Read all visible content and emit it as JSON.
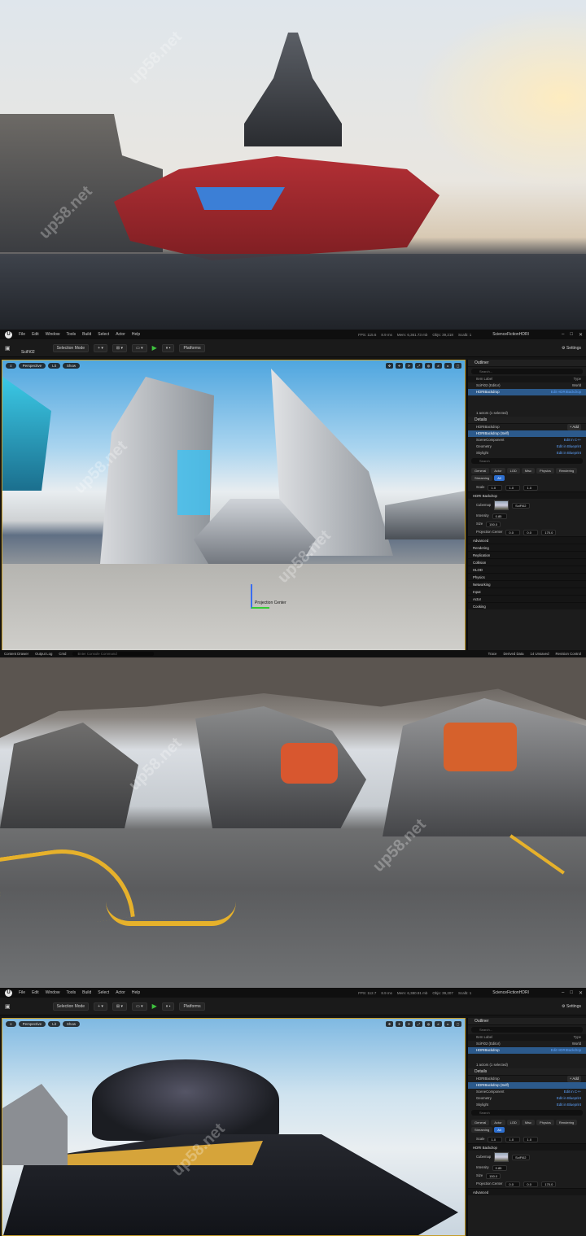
{
  "editor1": {
    "menu": [
      "File",
      "Edit",
      "Window",
      "Tools",
      "Build",
      "Select",
      "Actor",
      "Help"
    ],
    "level": "SciFi02",
    "stats": [
      "FPS: 115.6",
      "8.9 ms",
      "Mem: 6,361.73 mb",
      "Objs: 39,218",
      "Scalb: 1"
    ],
    "project": "ScienceFictionHDRI",
    "mode": "Selection Mode",
    "platforms": "Platforms",
    "settings": "Settings",
    "viewport": {
      "perspective": "Perspective",
      "lit": "Lit",
      "show": "Show",
      "projection_label": "Projection Center"
    },
    "outliner": {
      "title": "Outliner",
      "search": "Search...",
      "col_label": "Item Label",
      "col_type": "Type",
      "rows": [
        {
          "label": "SciFi02 (Editor)",
          "type": "World"
        },
        {
          "label": "HDRIBackdrop",
          "type": "Edit HDRIBackdrop"
        }
      ],
      "footer": "1 actors (1 selected)"
    },
    "details": {
      "title": "Details",
      "actor": "HDRIBackdrop",
      "add": "+ Add",
      "self": "HDRIBackdrop (Self)",
      "components": [
        {
          "label": "SceneComponent",
          "link": "Edit in C++"
        },
        {
          "label": "Geometry",
          "link": "Edit in Blueprint"
        },
        {
          "label": "Skylight",
          "link": "Edit in Blueprint"
        }
      ],
      "search": "Search",
      "tabs": [
        "General",
        "Actor",
        "LOD",
        "Misc",
        "Physics",
        "Rendering",
        "Streaming",
        "All"
      ],
      "scale_label": "Scale",
      "scale": [
        "1.0",
        "1.0",
        "1.0"
      ],
      "section": "HDRI Backdrop",
      "cubemap_label": "Cubemap",
      "cubemap_value": "SciFi02",
      "intensity_label": "Intensity",
      "intensity": "0.85",
      "size_label": "Size",
      "size": "150.0",
      "proj_label": "Projection Center",
      "proj": [
        "0.0",
        "0.0",
        "170.0"
      ],
      "categories": [
        "Advanced",
        "Rendering",
        "Replication",
        "Collision",
        "HLOD",
        "Physics",
        "Networking",
        "Input",
        "Actor",
        "Cooking"
      ]
    },
    "status": {
      "content_drawer": "Content Drawer",
      "output_log": "Output Log",
      "cmd": "Cmd",
      "cmd_placeholder": "Enter Console Command",
      "trace": "Trace",
      "derived": "Derived Data",
      "unsaved": "14 Unsaved",
      "revision": "Revision Control"
    }
  },
  "editor2": {
    "stats": [
      "FPS: 112.7",
      "8.9 ms",
      "Mem: 6,380.91 mb",
      "Objs: 39,207",
      "Scalb: 1"
    ],
    "outliner_footer": "1 actors (1 selected)",
    "intensity": "0.85",
    "size": "150.0",
    "proj": [
      "0.0",
      "0.0",
      "170.0"
    ],
    "categories": [
      "Advanced"
    ]
  },
  "watermark": "up58.net"
}
